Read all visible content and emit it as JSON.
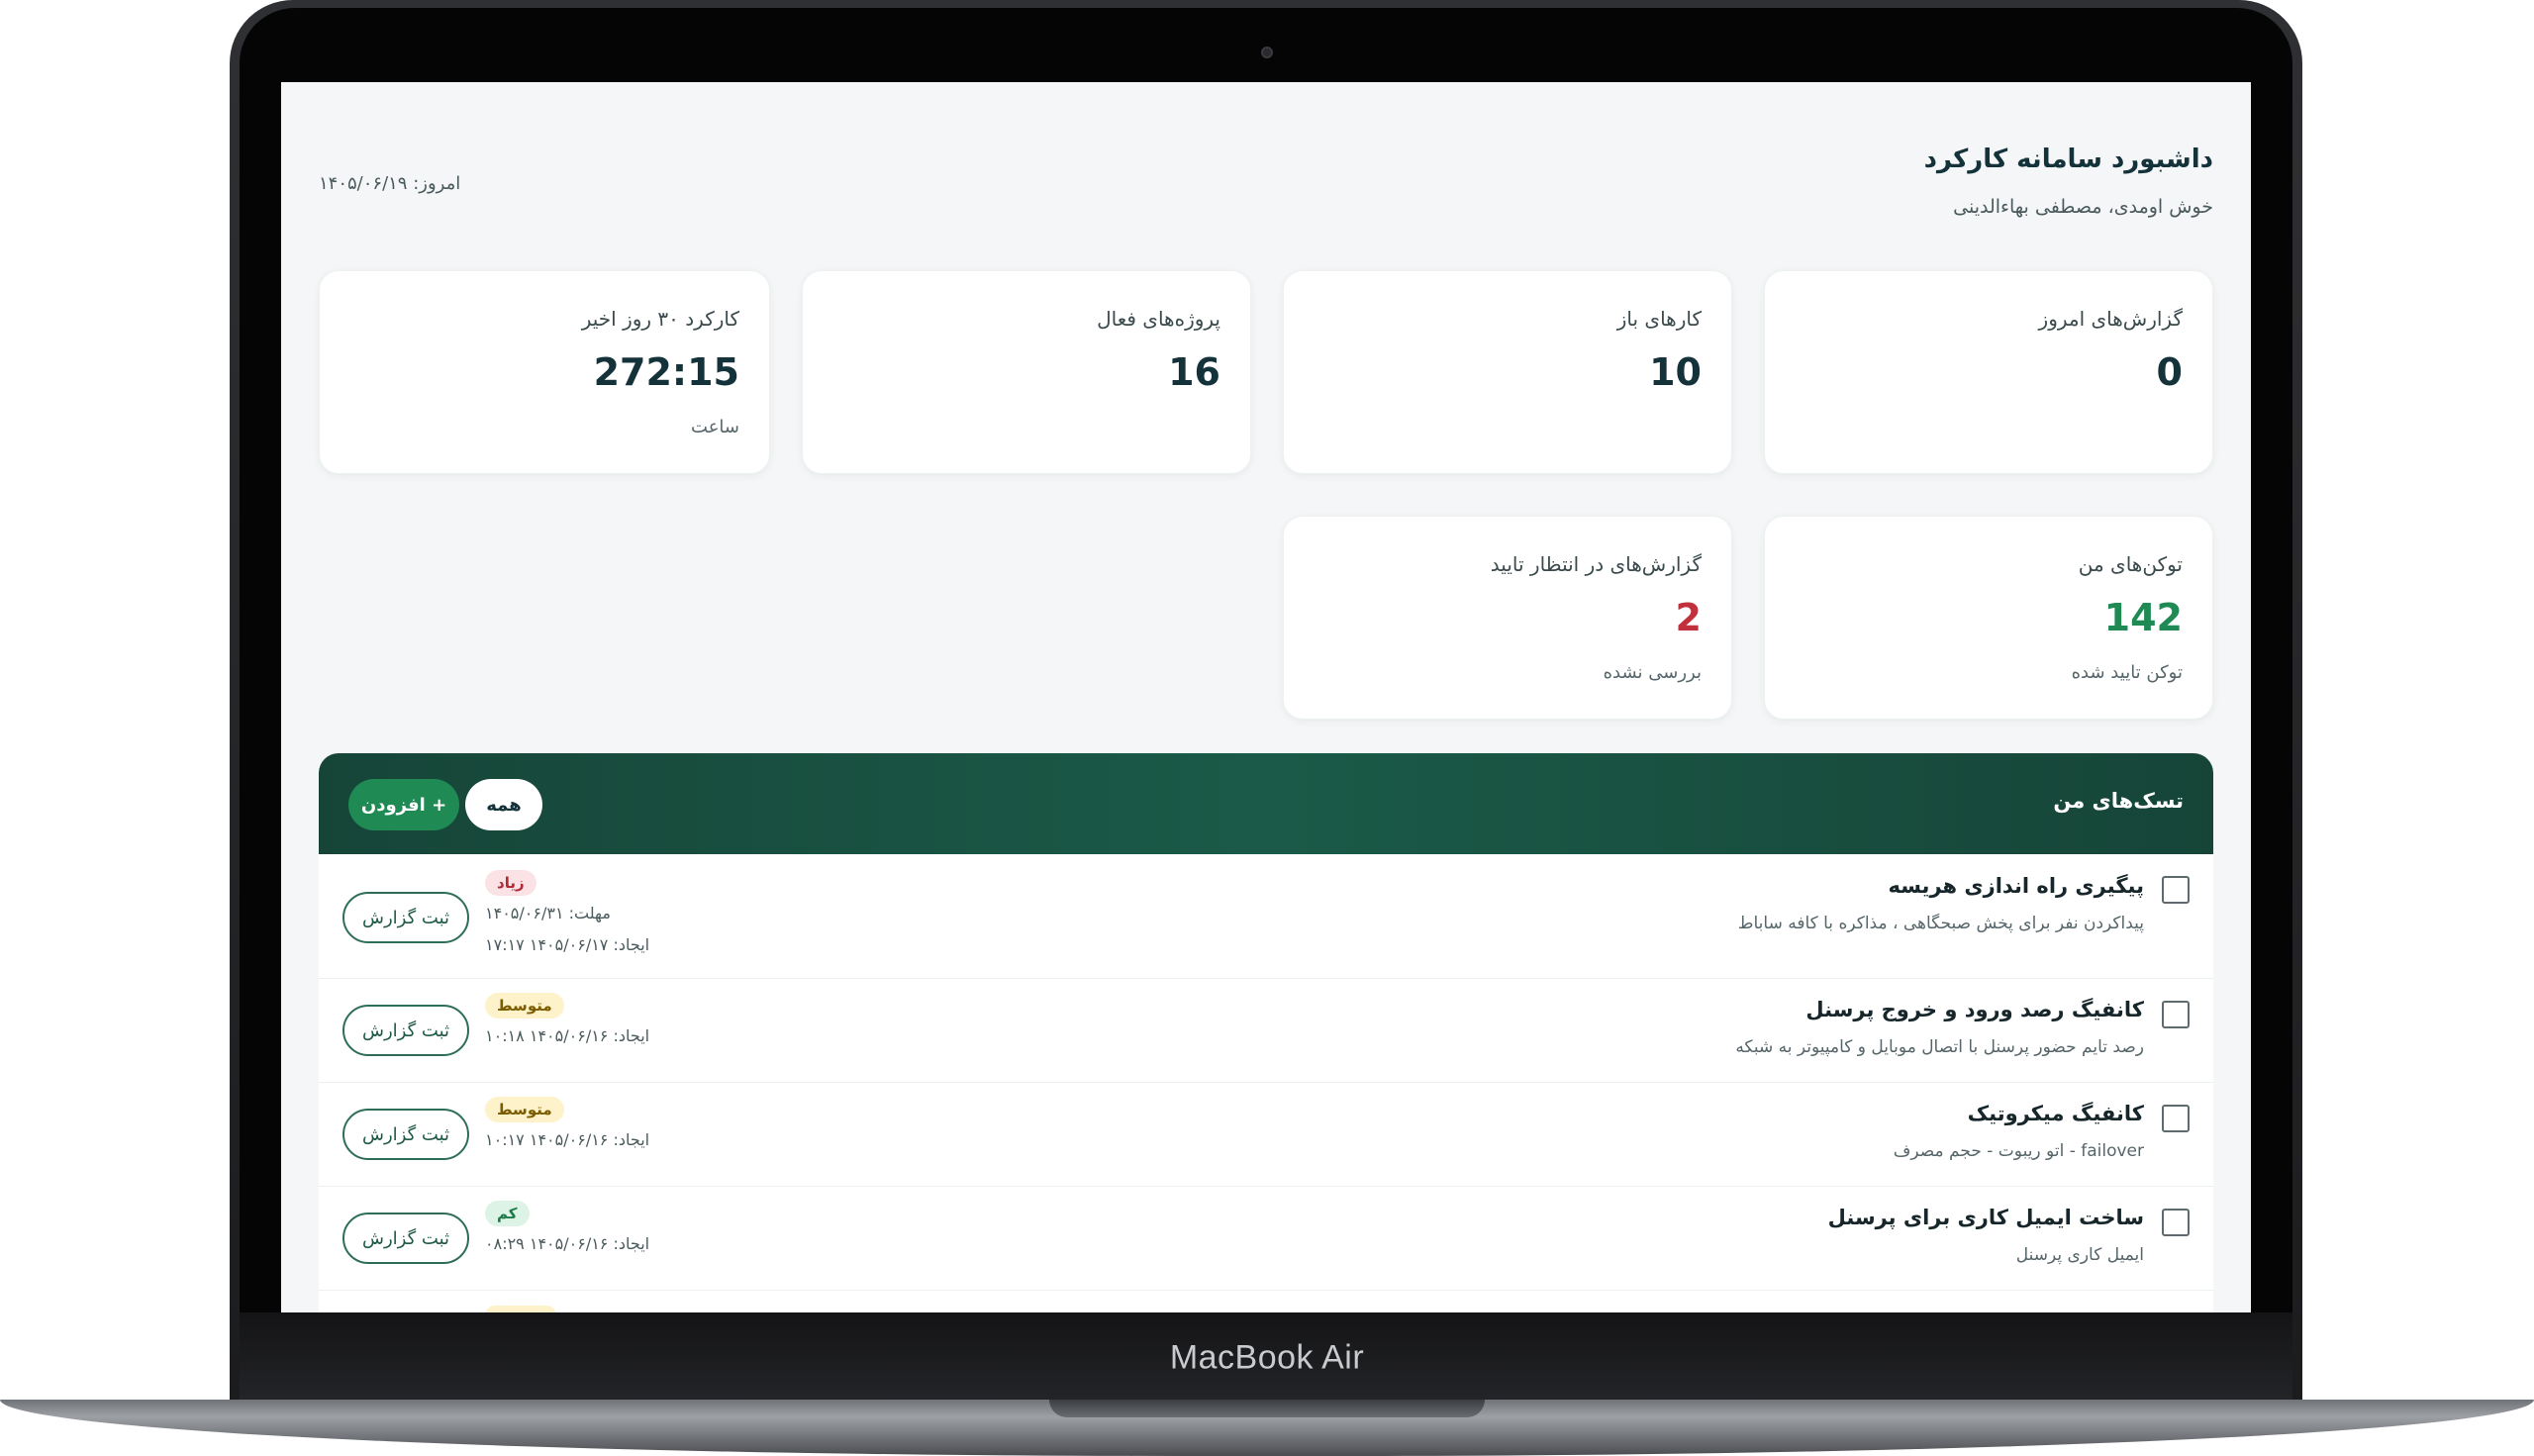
{
  "device": {
    "brand": "MacBook Air"
  },
  "header": {
    "title": "داشبورد سامانه کارکرد",
    "welcome": "خوش اومدی، مصطفی بهاءالدینی",
    "today": "امروز: ۱۴۰۵/۰۶/۱۹"
  },
  "stats": [
    {
      "label": "گزارش‌های امروز",
      "value": "0",
      "sub": ""
    },
    {
      "label": "کارهای باز",
      "value": "10",
      "sub": ""
    },
    {
      "label": "پروژه‌های فعال",
      "value": "16",
      "sub": ""
    },
    {
      "label": "کارکرد ۳۰ روز اخیر",
      "value": "272:15",
      "sub": "ساعت"
    },
    {
      "label": "توکن‌های من",
      "value": "142",
      "sub": "توکن تایید شده",
      "value_color": "#1f8a54"
    },
    {
      "label": "گزارش‌های در انتظار تایید",
      "value": "2",
      "sub": "بررسی نشده",
      "value_color": "#c0313d"
    }
  ],
  "tasks": {
    "title": "تسک‌های من",
    "filter_all": "همه",
    "add_label": "+ افزودن",
    "items": [
      {
        "title": "پیگیری راه اندازی هریسه",
        "desc": "پیداکردن نفر برای پخش صبحگاهی ، مذاکره با کافه ساباط",
        "priority": "زیاد",
        "deadline": "مهلت: ۱۴۰۵/۰۶/۳۱",
        "created": "ایجاد: ۱۴۰۵/۰۶/۱۷ ۱۷:۱۷",
        "action": "ثبت گزارش"
      },
      {
        "title": "کانفیگ رصد ورود و خروج پرسنل",
        "desc": "رصد تایم حضور پرسنل با اتصال موبایل و کامپیوتر به شبکه",
        "priority": "متوسط",
        "created": "ایجاد: ۱۴۰۵/۰۶/۱۶ ۱۰:۱۸",
        "action": "ثبت گزارش"
      },
      {
        "title": "کانفیگ میکروتیک",
        "desc": "failover - اتو ریبوت - حجم مصرف",
        "priority": "متوسط",
        "created": "ایجاد: ۱۴۰۵/۰۶/۱۶ ۱۰:۱۷",
        "action": "ثبت گزارش"
      },
      {
        "title": "ساخت ایمیل کاری برای پرسنل",
        "desc": "ایمیل کاری پرسنل",
        "priority": "کم",
        "created": "ایجاد: ۱۴۰۵/۰۶/۱۶ ۰۸:۲۹",
        "action": "ثبت گزارش"
      }
    ]
  },
  "colors": {
    "brand_dark": "#164538",
    "accent_green": "#1f8a54",
    "alert_red": "#c0313d"
  }
}
